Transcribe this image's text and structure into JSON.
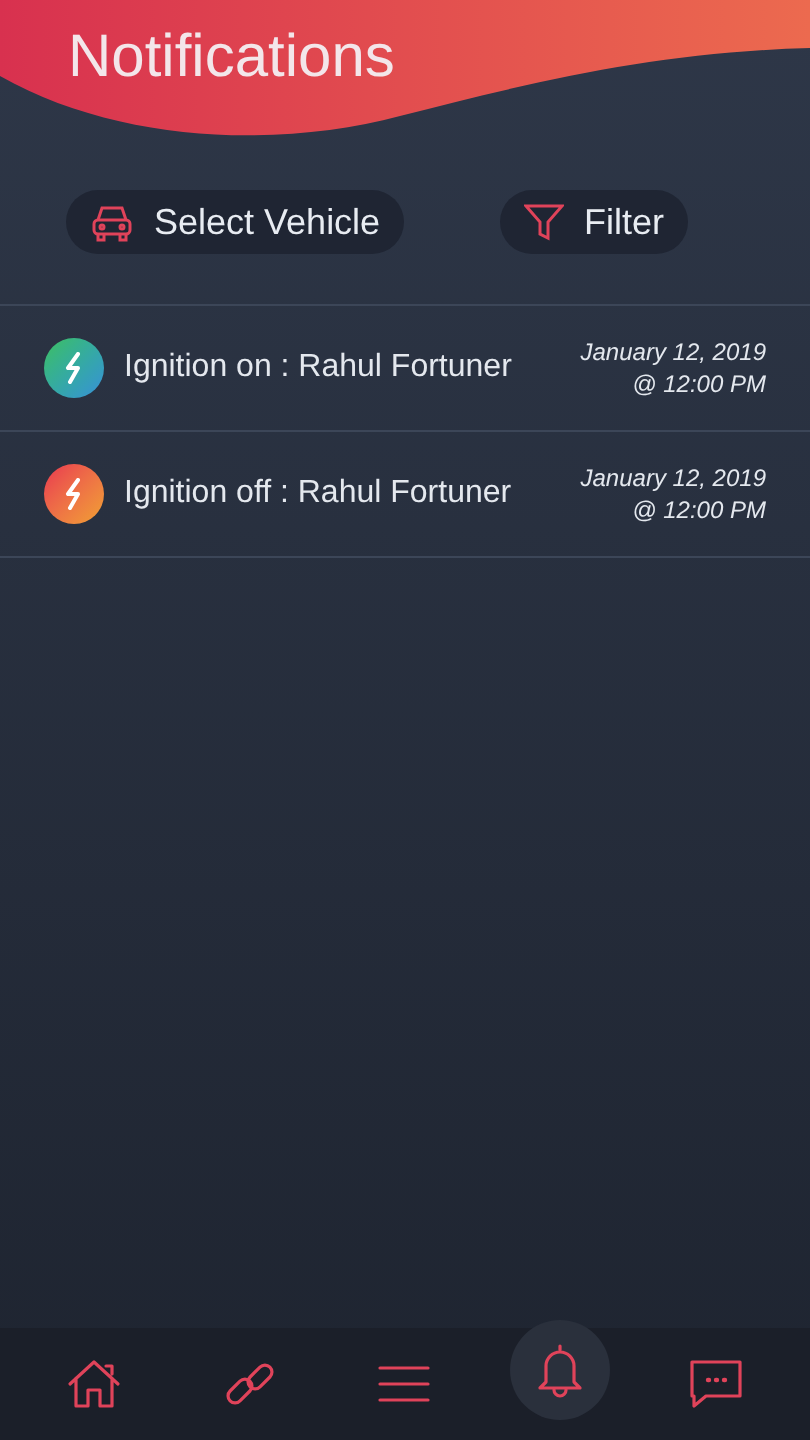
{
  "header": {
    "title": "Notifications"
  },
  "toolbar": [
    {
      "kind": "vehicle",
      "label": "Select Vehicle"
    },
    {
      "kind": "filter",
      "label": "Filter"
    }
  ],
  "notifications": [
    {
      "kind": "on",
      "text": "Ignition on : Rahul Fortuner",
      "date": "January 12, 2019",
      "time": "@ 12:00 PM"
    },
    {
      "kind": "off",
      "text": "Ignition off : Rahul Fortuner",
      "date": "January 12, 2019",
      "time": "@ 12:00 PM"
    }
  ],
  "bottom_nav": [
    {
      "kind": "home",
      "selected": false
    },
    {
      "kind": "link",
      "selected": false
    },
    {
      "kind": "menu",
      "selected": false
    },
    {
      "kind": "bell",
      "selected": true
    },
    {
      "kind": "chat",
      "selected": false
    }
  ]
}
